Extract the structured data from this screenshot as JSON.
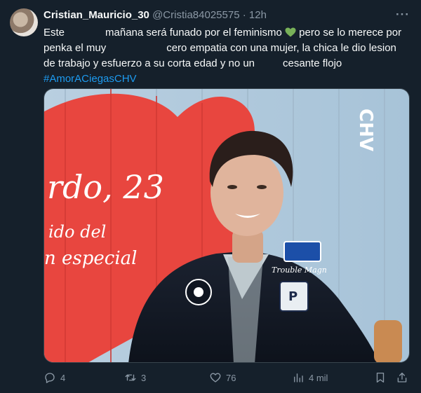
{
  "tweet": {
    "display_name": "Cristian_Mauricio_30",
    "handle": "@Cristia84025575",
    "separator": "·",
    "time": "12h",
    "more_glyph": "···",
    "text": {
      "l1_a": "Este",
      "l1_b": "mañana será funado por el feminismo",
      "l1_c": "pero se lo merece por",
      "l2_a": "penka el muy",
      "l2_b": "cero empatia con una mujer, la chica le dio lesion",
      "l3": "de trabajo y esfuerzo a su corta edad y no un",
      "l3_b": "cesante flojo",
      "hashtag": "#AmorACiegasCHV"
    },
    "media": {
      "overlay_line1": "rdo, 23",
      "overlay_line2": "ido del",
      "overlay_line3": "n especial",
      "channel_logo": "CHV",
      "jacket_script": "Trouble Magn",
      "patch_letter": "P"
    },
    "actions": {
      "replies": "4",
      "reposts": "3",
      "likes": "76",
      "views": "4 mil"
    }
  },
  "colors": {
    "background": "#15202b",
    "text": "#f7f9f9",
    "secondary": "#8b98a5",
    "link": "#1d9bf0",
    "heart": "#78b159"
  }
}
